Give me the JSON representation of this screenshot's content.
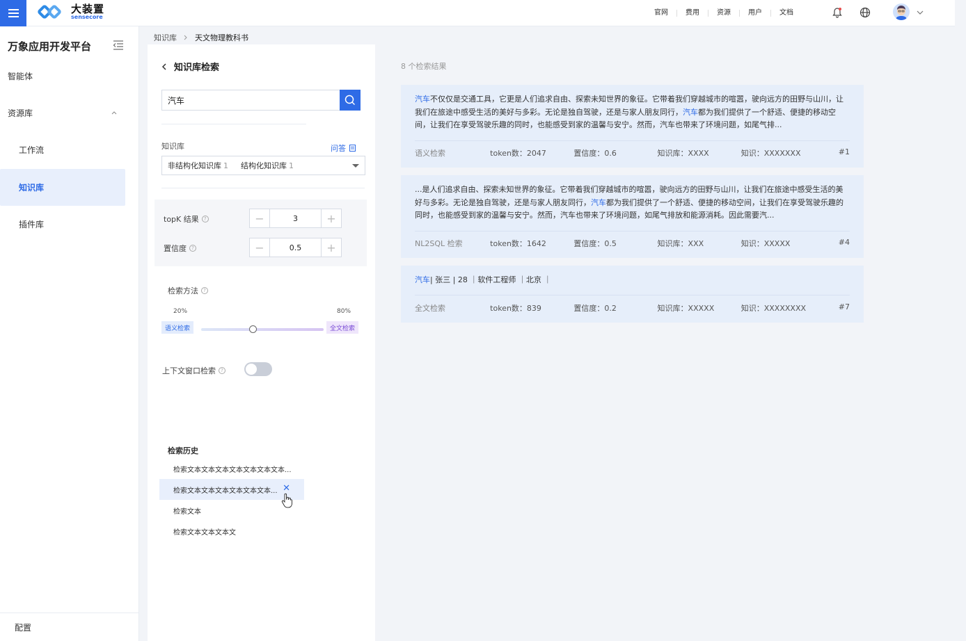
{
  "header": {
    "logo_cn": "大装置",
    "logo_en": "sensecore",
    "nav": [
      "官网",
      "费用",
      "资源",
      "用户",
      "文档"
    ]
  },
  "sidebar": {
    "title": "万象应用开发平台",
    "items": [
      {
        "label": "智能体",
        "level": "top"
      },
      {
        "label": "资源库",
        "level": "top",
        "expanded": true
      },
      {
        "label": "工作流",
        "level": "sub"
      },
      {
        "label": "知识库",
        "level": "sub",
        "active": true
      },
      {
        "label": "插件库",
        "level": "sub"
      }
    ],
    "footer": "配置"
  },
  "breadcrumb": [
    "知识库",
    "天文物理教科书"
  ],
  "panel": {
    "title": "知识库检索",
    "search_value": "汽车",
    "kb_label": "知识库",
    "qa_link": "问答",
    "kb_select": [
      {
        "label": "非结构化知识库",
        "count": "1"
      },
      {
        "label": "结构化知识库",
        "count": "1"
      }
    ],
    "topk_label": "topK 结果",
    "topk_value": "3",
    "conf_label": "置信度",
    "conf_value": "0.5",
    "method_label": "检索方法",
    "method_left_pct": "20%",
    "method_right_pct": "80%",
    "method_left_tag": "语义检索",
    "method_right_tag": "全文检索",
    "method_ratio": 0.2,
    "context_label": "上下文窗口检索",
    "context_enabled": false,
    "history_title": "检索历史",
    "history": [
      "检索文本文本文本文本文本文本文本...",
      "检索文本文本文本文本文本文本...",
      "检索文本",
      "检索文本文本文本文"
    ]
  },
  "results": {
    "count_label": "8 个检索结果",
    "items": [
      {
        "highlight": "汽车",
        "text_a": "不仅仅是交通工具，它更是人们追求自由、探索未知世界的象征。它带着我们穿越城市的喧嚣，驶向远方的田野与山川，让我们在旅途中感受生活的美好与多彩。无论是独自驾驶，还是与家人朋友同行，",
        "highlight2": "汽车",
        "text_b": "都为我们提供了一个舒适、便捷的移动空间，让我们在享受驾驶乐趣的同时，也能感受到家的温馨与安宁。然而，汽车也带来了环境问题，如尾气排...",
        "method": "语义检索",
        "token": "token数：2047",
        "conf": "置信度：0.6",
        "kb": "知识库：XXXX",
        "knowledge": "知识：XXXXXXX",
        "rank": "#1"
      },
      {
        "highlight": "",
        "text_a": "...是人们追求自由、探索未知世界的象征。它带着我们穿越城市的喧嚣，驶向远方的田野与山川，让我们在旅途中感受生活的美好与多彩。无论是独自驾驶，还是与家人朋友同行，",
        "highlight2": "汽车",
        "text_b": "都为我们提供了一个舒适、便捷的移动空间，让我们在享受驾驶乐趣的同时，也能感受到家的温馨与安宁。然而，汽车也带来了环境问题，如尾气排放和能源消耗。因此需要汽...",
        "method": "NL2SQL 检索",
        "token": "token数：1642",
        "conf": "置信度：0.5",
        "kb": "知识库：XXX",
        "knowledge": "知识：XXXXX",
        "rank": "#4"
      },
      {
        "highlight": "汽车",
        "text_a": "| 张三 | 28 ｜软件工程师 ｜北京 ｜",
        "highlight2": "",
        "text_b": "",
        "method": "全文检索",
        "token": "token数：839",
        "conf": "置信度：0.2",
        "kb": "知识库：XXXXX",
        "knowledge": "知识：XXXXXXXX",
        "rank": "#7"
      }
    ]
  },
  "colors": {
    "accent": "#2e6be6",
    "active_bg": "#e8effc",
    "card_bg": "#e6eefa"
  }
}
